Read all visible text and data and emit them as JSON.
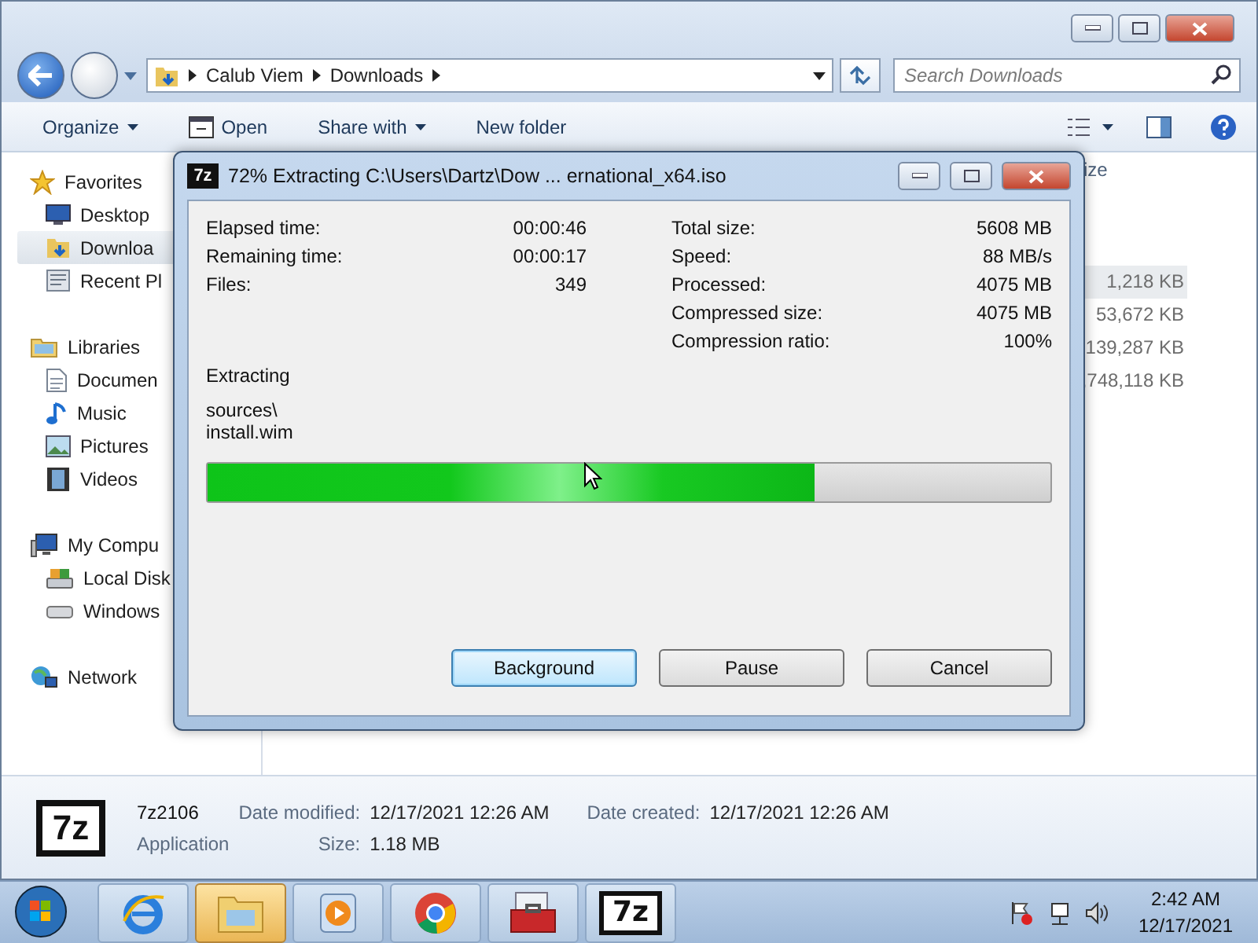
{
  "explorer": {
    "breadcrumbs": [
      "Calub Viem",
      "Downloads"
    ],
    "search": {
      "placeholder": "Search Downloads"
    },
    "toolbar": [
      "Organize",
      "Open",
      "Share with",
      "New folder"
    ],
    "sidebar": [
      {
        "label": "Favorites",
        "kind": "star",
        "selected": false,
        "children": [
          {
            "label": "Desktop",
            "kind": "desktop",
            "selected": false
          },
          {
            "label": "Downloa",
            "kind": "downloads",
            "selected": true
          },
          {
            "label": "Recent Pl",
            "kind": "recent",
            "selected": false
          }
        ]
      },
      {
        "label": "Libraries",
        "kind": "library",
        "selected": false,
        "children": [
          {
            "label": "Documen",
            "kind": "document",
            "selected": false
          },
          {
            "label": "Music",
            "kind": "music",
            "selected": false
          },
          {
            "label": "Pictures",
            "kind": "pictures",
            "selected": false
          },
          {
            "label": "Videos",
            "kind": "videos",
            "selected": false
          }
        ]
      },
      {
        "label": "My Compu",
        "kind": "computer",
        "selected": false,
        "children": [
          {
            "label": "Local Disk",
            "kind": "disk",
            "selected": false
          },
          {
            "label": "Windows",
            "kind": "drive",
            "selected": false
          }
        ]
      },
      {
        "label": "Network",
        "kind": "network",
        "selected": false
      }
    ],
    "size_header": "ize",
    "sizes": [
      {
        "text": "1,218 KB",
        "selected": true
      },
      {
        "text": "53,672 KB",
        "selected": false
      },
      {
        "text": "139,287 KB",
        "selected": false
      },
      {
        "text": ",748,118 KB",
        "selected": false
      }
    ],
    "details": {
      "icon": "7z",
      "name": "7z2106",
      "type": "Application",
      "fields": [
        {
          "label": "Date modified:",
          "value": "12/17/2021 12:26 AM"
        },
        {
          "label": "Date created:",
          "value": "12/17/2021 12:26 AM"
        },
        {
          "label": "Size:",
          "value": "1.18 MB"
        }
      ]
    }
  },
  "dialog": {
    "icon": "7z",
    "title": "72% Extracting C:\\Users\\Dartz\\Dow ... ernational_x64.iso",
    "left_stats": [
      {
        "label": "Elapsed time:",
        "value": "00:00:46"
      },
      {
        "label": "Remaining time:",
        "value": "00:00:17"
      },
      {
        "label": "Files:",
        "value": "349"
      }
    ],
    "right_stats": [
      {
        "label": "Total size:",
        "value": "5608 MB"
      },
      {
        "label": "Speed:",
        "value": "88 MB/s"
      },
      {
        "label": "Processed:",
        "value": "4075 MB"
      },
      {
        "label": "Compressed size:",
        "value": "4075 MB"
      },
      {
        "label": "Compression ratio:",
        "value": "100%"
      }
    ],
    "status": "Extracting",
    "path_lines": [
      "sources\\",
      "install.wim"
    ],
    "level": 0.72,
    "buttons": [
      {
        "label": "Background",
        "selected": true
      },
      {
        "label": "Pause",
        "selected": false
      },
      {
        "label": "Cancel",
        "selected": false
      }
    ]
  },
  "taskbar": {
    "apps": [
      {
        "kind": "ie",
        "selected": false
      },
      {
        "kind": "explorer",
        "selected": true
      },
      {
        "kind": "media",
        "selected": false
      },
      {
        "kind": "chrome",
        "selected": false
      },
      {
        "kind": "toolbox",
        "selected": false
      },
      {
        "kind": "sevenzip",
        "label": "7z",
        "selected": false
      }
    ],
    "time": "2:42 AM",
    "date": "12/17/2021"
  }
}
